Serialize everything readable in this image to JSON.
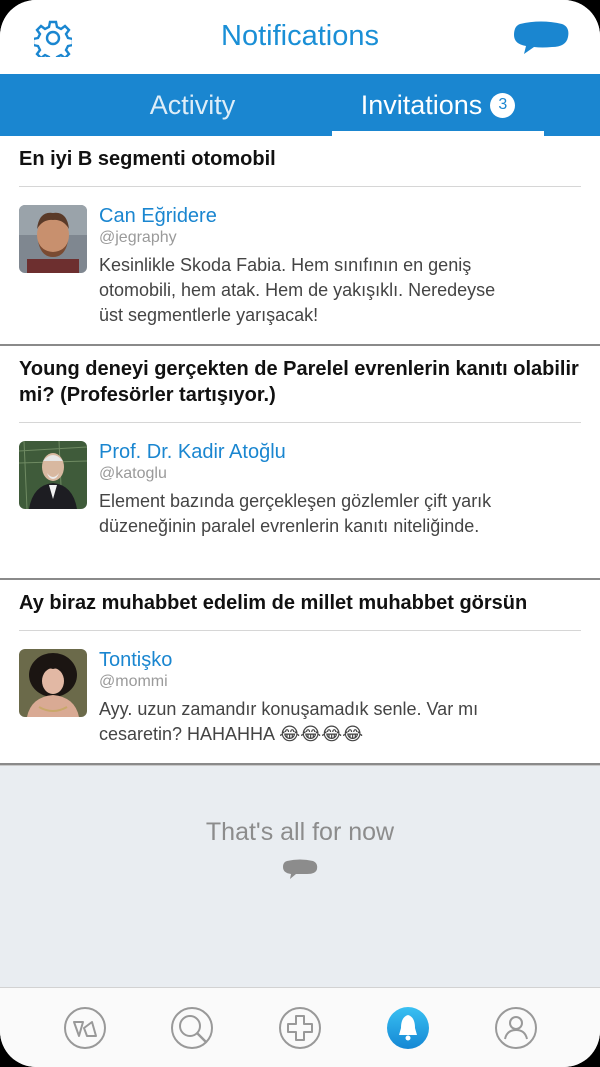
{
  "header": {
    "title": "Notifications",
    "settings_icon": "gear-icon",
    "messages_icon": "chat-bubble-icon"
  },
  "tabs": [
    {
      "label": "Activity",
      "active": false
    },
    {
      "label": "Invitations",
      "active": true,
      "badge": "3"
    }
  ],
  "topics": [
    {
      "title": "En iyi B segmenti otomobil",
      "author": "Can Eğridere",
      "handle": "@jegraphy",
      "text": "Kesinlikle Skoda Fabia. Hem sınıfının en geniş otomobili, hem atak. Hem de yakışıklı. Neredeyse üst segmentlerle yarışacak!"
    },
    {
      "title": "Young deneyi gerçekten de Parelel evrenlerin kanıtı olabilir mi? (Profesörler tartışıyor.)",
      "author": "Prof. Dr. Kadir Atoğlu",
      "handle": "@katoglu",
      "text": "Element bazında gerçekleşen gözlemler çift yarık düzeneğinin paralel evrenlerin kanıtı niteliğinde."
    },
    {
      "title": "Ay biraz muhabbet edelim de millet muhabbet görsün",
      "author": "Tontişko",
      "handle": "@mommi",
      "text": "Ayy. uzun zamandır konuşamadık senle. Var mı cesaretin? HAHAHHA 😂😂😂😂"
    }
  ],
  "end_message": "That's all for now",
  "bottom_nav": [
    "home-icon",
    "search-icon",
    "add-icon",
    "notifications-icon",
    "profile-icon"
  ],
  "colors": {
    "accent": "#1a86d0",
    "title": "#1a8fd6",
    "footer_bg": "#e9edf1"
  }
}
